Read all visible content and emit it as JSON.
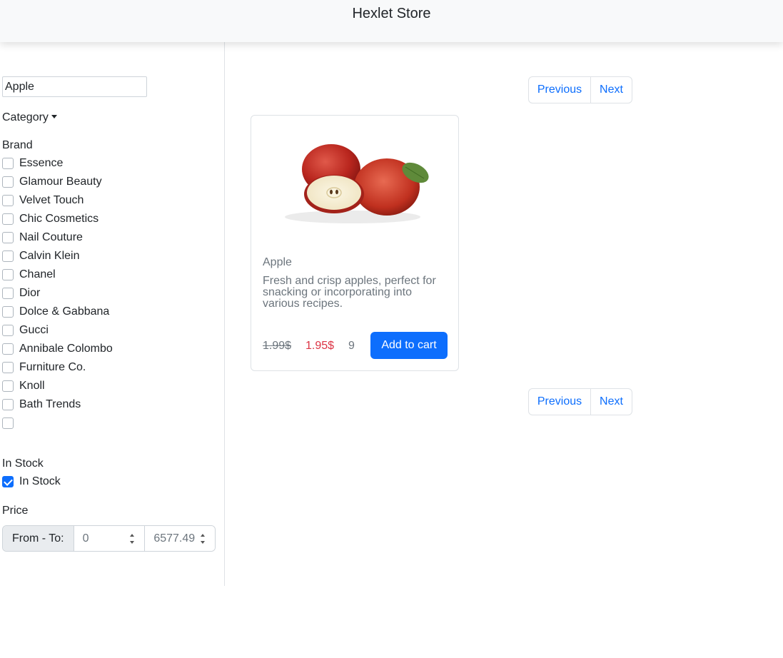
{
  "header": {
    "brand": "Hexlet Store"
  },
  "sidebar": {
    "search": {
      "value": "Apple"
    },
    "category_label": "Category",
    "brand": {
      "title": "Brand",
      "items": [
        {
          "label": "Essence",
          "checked": false
        },
        {
          "label": "Glamour Beauty",
          "checked": false
        },
        {
          "label": "Velvet Touch",
          "checked": false
        },
        {
          "label": "Chic Cosmetics",
          "checked": false
        },
        {
          "label": "Nail Couture",
          "checked": false
        },
        {
          "label": "Calvin Klein",
          "checked": false
        },
        {
          "label": "Chanel",
          "checked": false
        },
        {
          "label": "Dior",
          "checked": false
        },
        {
          "label": "Dolce & Gabbana",
          "checked": false
        },
        {
          "label": "Gucci",
          "checked": false
        },
        {
          "label": "Annibale Colombo",
          "checked": false
        },
        {
          "label": "Furniture Co.",
          "checked": false
        },
        {
          "label": "Knoll",
          "checked": false
        },
        {
          "label": "Bath Trends",
          "checked": false
        },
        {
          "label": "",
          "checked": false
        }
      ]
    },
    "stock": {
      "title": "In Stock",
      "label": "In Stock",
      "checked": true
    },
    "price": {
      "title": "Price",
      "prefix": "From - To:",
      "from": "0",
      "to": "6577.49"
    }
  },
  "pagination": {
    "prev": "Previous",
    "next": "Next"
  },
  "products": [
    {
      "title": "Apple",
      "description": "Fresh and crisp apples, perfect for snacking or incorporating into various recipes.",
      "old_price": "1.99$",
      "new_price": "1.95$",
      "stock": "9",
      "button": "Add to cart"
    }
  ],
  "colors": {
    "primary": "#0d6efd",
    "sale": "#dc3545",
    "muted": "#6c757d",
    "navbar": "#f8f9fa"
  }
}
